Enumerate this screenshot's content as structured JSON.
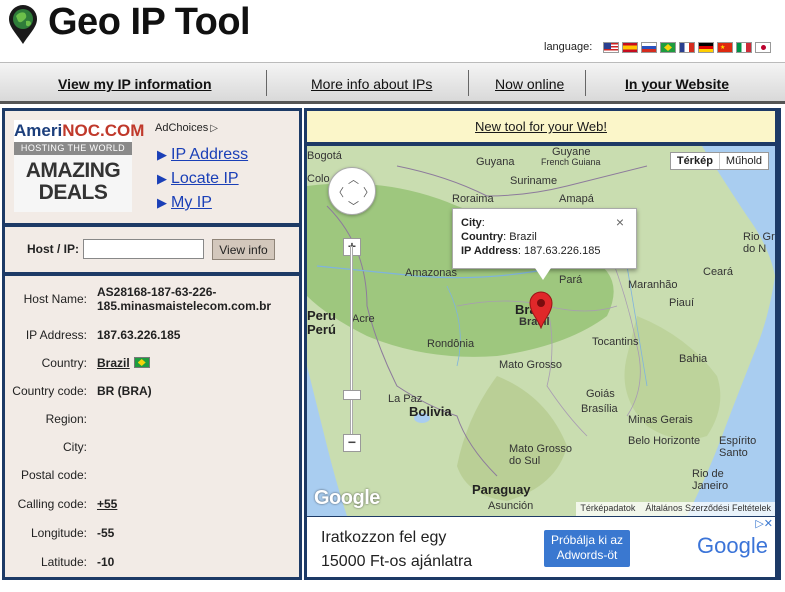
{
  "header": {
    "title": "Geo IP Tool",
    "language_label": "language:",
    "flags": [
      "US",
      "ES",
      "RU",
      "BR",
      "FR",
      "DE",
      "CN",
      "IT",
      "JP"
    ]
  },
  "nav": {
    "items": [
      "View my IP information",
      "More info about IPs",
      "Now online",
      "In your Website"
    ]
  },
  "ad": {
    "brand_prefix": "Ameri",
    "brand_suffix": "NOC.COM",
    "tagline": "HOSTING THE WORLD",
    "deal_line1": "AMAZING",
    "deal_line2": "DEALS",
    "adchoices": "AdChoices",
    "links": [
      "IP Address",
      "Locate IP",
      "My IP"
    ]
  },
  "search": {
    "label": "Host / IP:",
    "value": "",
    "button": "View info"
  },
  "info": {
    "rows": [
      {
        "label": "Host Name:",
        "value": "AS28168-187-63-226-",
        "value2": "185.minasmaistelecom.com.br"
      },
      {
        "label": "IP Address:",
        "value": "187.63.226.185"
      },
      {
        "label": "Country:",
        "value": "Brazil"
      },
      {
        "label": "Country code:",
        "value": "BR (BRA)"
      },
      {
        "label": "Region:",
        "value": ""
      },
      {
        "label": "City:",
        "value": ""
      },
      {
        "label": "Postal code:",
        "value": ""
      },
      {
        "label": "Calling code:",
        "value": "+55"
      },
      {
        "label": "Longitude:",
        "value": "-55"
      },
      {
        "label": "Latitude:",
        "value": "-10"
      }
    ]
  },
  "notice": "New tool for your Web!",
  "map": {
    "type_buttons": [
      "Térkép",
      "Műhold"
    ],
    "info_window": {
      "city_label": "City",
      "city_value": ":",
      "country_label": "Country",
      "country_value": ": Brazil",
      "ip_label": "IP Address",
      "ip_value": ": 187.63.226.185",
      "close": "×"
    },
    "labels": [
      "Bogotá",
      "Guyana",
      "Guyane",
      "French Guiana",
      "Suriname",
      "Roraima",
      "Amapá",
      "Rio Gr do N",
      "Amazonas",
      "Pará",
      "Maranhão",
      "Ceará",
      "Peru",
      "Perú",
      "Acre",
      "Brazil",
      "Brasil",
      "Piauí",
      "Rondônia",
      "Tocantins",
      "Bahia",
      "Mato Grosso",
      "Goiás",
      "Brasília",
      "La Paz",
      "Bolivia",
      "Minas Gerais",
      "Belo Horizonte",
      "Espírito Santo",
      "Mato Grosso do Sul",
      "Rio de Janeiro",
      "Paraguay",
      "Asunción",
      "Colo"
    ],
    "footer": [
      "Térképadatok",
      "Általános Szerződési Feltételek"
    ],
    "google": "Google"
  },
  "bottom_ad": {
    "line1": "Iratkozzon fel egy",
    "line2": "15000 Ft-os ajánlatra",
    "button": "Próbálja ki az Adwords-öt",
    "logo": "Google"
  },
  "colors": {
    "frame": "#1d3a66",
    "panel": "#f2ebe6",
    "link": "#1a3fb7",
    "notice_bg": "#fbf6c9"
  }
}
